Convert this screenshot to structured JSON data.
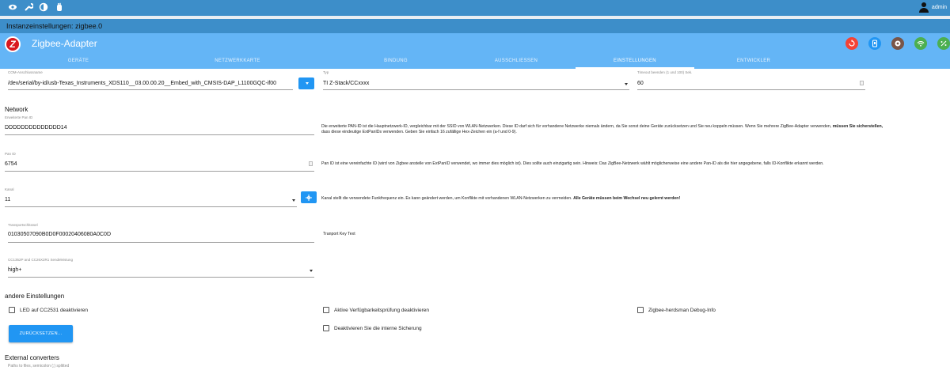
{
  "topbar": {
    "icons": [
      "eye-icon",
      "wrench-icon",
      "contrast-icon",
      "hand-icon"
    ],
    "user": "admin"
  },
  "instance_title": "Instanzeinstellungen: zigbee.0",
  "header": {
    "title": "Zigbee-Adapter",
    "logo_letter": "Z",
    "buttons": [
      {
        "name": "restart-icon",
        "color": "#f44336"
      },
      {
        "name": "device-icon",
        "color": "#2196f3"
      },
      {
        "name": "cog-icon",
        "color": "#795548"
      },
      {
        "name": "wifi-icon",
        "color": "#4caf50"
      },
      {
        "name": "percent-icon",
        "color": "#4caf50"
      }
    ]
  },
  "tabs": [
    "GERÄTE",
    "NETZWERKKARTE",
    "BINDUNG",
    "AUSSCHLIESSEN",
    "EINSTELLUNGEN",
    "ENTWICKLER"
  ],
  "active_tab": "EINSTELLUNGEN",
  "com": {
    "label": "COM-Anschlussname",
    "value": "/dev/serial/by-id/usb-Texas_Instruments_XDS110__03.00.00.20__Embed_with_CMSIS-DAP_L1100GQC-if00"
  },
  "typ": {
    "label": "Typ",
    "value": "TI Z-Stack/CCxxxx"
  },
  "timeout": {
    "label": "Timeout beenden (1 und 100) Sek.",
    "value": "60"
  },
  "network_heading": "Network",
  "extpanid": {
    "label": "Erweiterte Pan ID",
    "value": "DDDDDDDDDDDDDD14",
    "desc": "Die erweiterte PAN-ID ist die Hauptnetzwerk-ID, vergleichbar mit der SSID von WLAN-Netzwerken. Diese ID darf sich für vorhandene Netzwerke niemals ändern, da Sie sonst deine Geräte zurücksetzen und Sie neu koppeln müssen. Wenn Sie mehrere ZigBee-Adapter verwenden,",
    "desc_bold": "müssen Sie sicherstellen,",
    "desc2": "dass diese eindeutige ExtPanIDs verwenden. Geben Sie einfach 16 zufällige Hex-Zeichen ein (a-f und 0-9)."
  },
  "panid": {
    "label": "Pan ID",
    "value": "6754",
    "desc": "Pan ID ist eine vereinfachte ID (wird von Zigbee anstelle von ExtPanID verwendet, wo immer dies möglich ist). Dies sollte auch einzigartig sein. Hinweis: Das ZigBee-Netzwerk wählt möglicherweise eine andere Pan-ID als die hier angegebene, falls ID-Konflikte erkannt werden."
  },
  "kanal": {
    "label": "Kanal",
    "value": "11",
    "desc": "Kanal stellt die verwendete Funkfrequenz ein. Es kann geändert werden, um Konflikte mit vorhandenen WLAN-Netzwerken zu vermeiden.",
    "desc_bold": "Alle Geräte müssen beim Wechsel neu gelernt werden!"
  },
  "transport": {
    "label": "Transportschlüssel",
    "value": "01030507090B0D0F00020406080A0C0D",
    "desc": "Tranport Key Text"
  },
  "power": {
    "label": "CC1352P and CC26X2R1 Sendeleistung",
    "value": "high+"
  },
  "other_heading": "andere Einstellungen",
  "checkboxes": {
    "led": "LED auf CC2531 deaktivieren",
    "avail": "Aktive Verfügbarkeitsprüfung deaktivieren",
    "debug": "Zigbee-herdsman Debug-Info",
    "backup": "Deaktivieren Sie die interne Sicherung"
  },
  "reset_label": "ZURÜCKSETZEN...",
  "converters_heading": "External converters",
  "converters_placeholder": "Paths to files, semicolon (;) splitted"
}
